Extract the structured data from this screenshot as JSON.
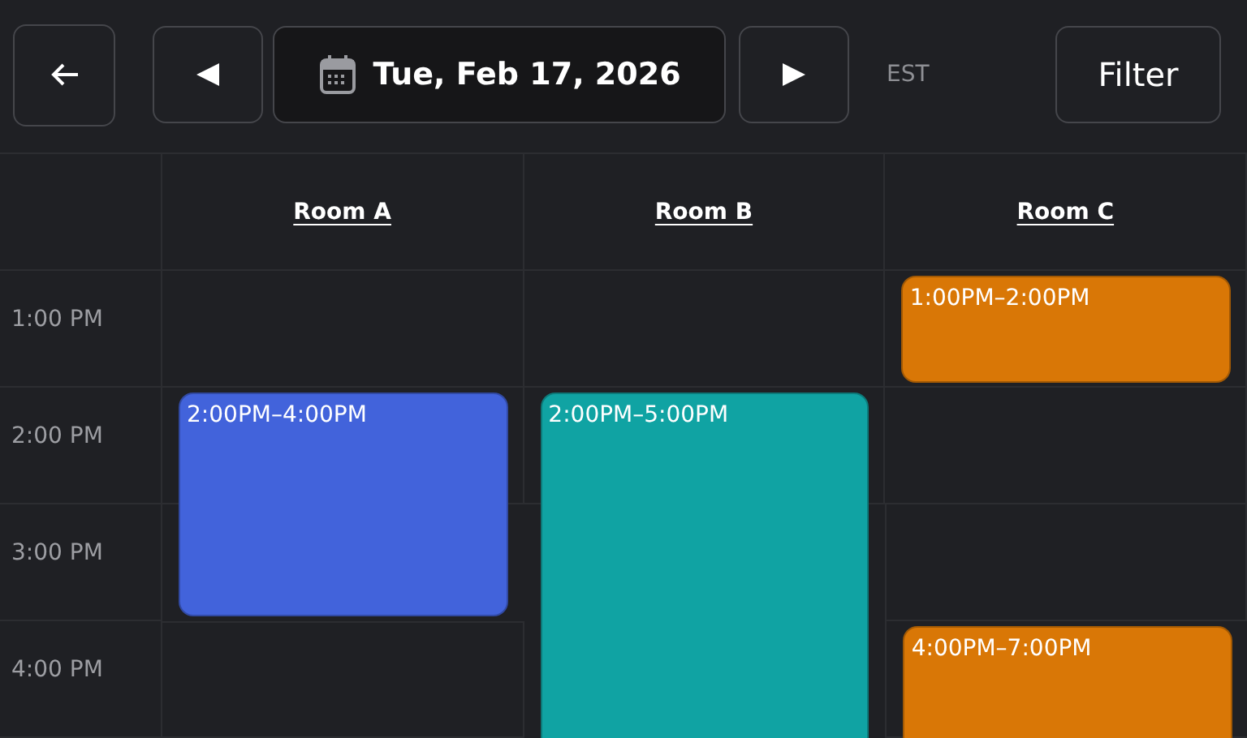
{
  "toolbar": {
    "date": "Tue, Feb 17, 2026",
    "timezone": "EST",
    "filter_label": "Filter"
  },
  "rooms": [
    {
      "name": "Room A",
      "slots": [
        {
          "kind": "empty"
        },
        {
          "kind": "start",
          "label": "2:00PM–4:00PM",
          "color": "#4263db"
        },
        {
          "kind": "continue"
        },
        {
          "kind": "empty"
        }
      ]
    },
    {
      "name": "Room B",
      "slots": [
        {
          "kind": "empty"
        },
        {
          "kind": "start",
          "label": "2:00PM–5:00PM",
          "color": "#10a3a3"
        },
        {
          "kind": "continue"
        },
        {
          "kind": "continue"
        }
      ]
    },
    {
      "name": "Room C",
      "slots": [
        {
          "kind": "start",
          "label": "1:00PM–2:00PM",
          "color": "#d97706"
        },
        {
          "kind": "empty"
        },
        {
          "kind": "empty"
        },
        {
          "kind": "start",
          "label": "4:00PM–7:00PM",
          "color": "#d97706"
        }
      ]
    }
  ],
  "hours": [
    "1:00 PM",
    "2:00 PM",
    "3:00 PM",
    "4:00 PM"
  ]
}
